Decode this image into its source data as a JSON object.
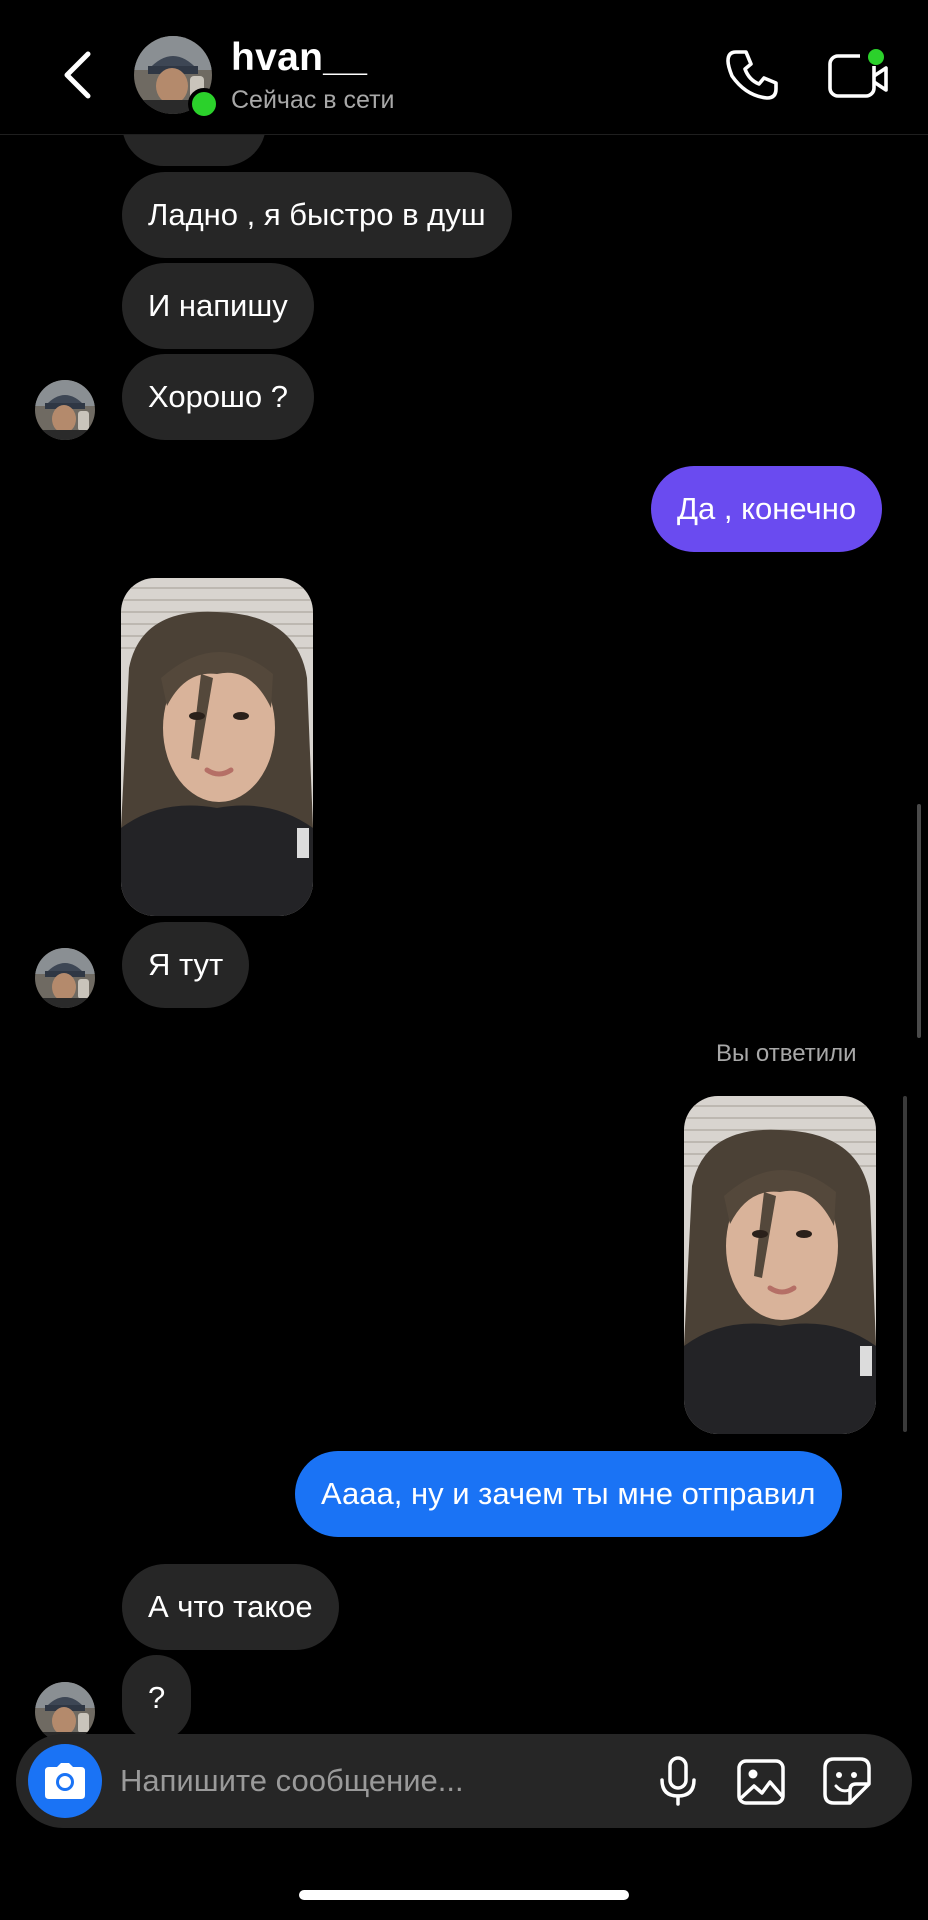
{
  "header": {
    "username": "hvan__",
    "status": "Сейчас в сети",
    "accent_online": "#2bd12b"
  },
  "icons": {
    "back": "chevron-left-icon",
    "call": "phone-icon",
    "video": "video-camera-icon",
    "camera": "camera-icon",
    "mic": "microphone-icon",
    "gallery": "image-icon",
    "sticker": "sticker-icon"
  },
  "messages": {
    "m1": "Ладно , я быстро в душ",
    "m2": "И напишу",
    "m3": "Хорошо ?",
    "m4": "Да , конечно",
    "m5": "Я тут",
    "reply_label": "Вы ответили",
    "m6": "Аааа, ну и зачем ты мне отправил",
    "m7": "А что такое",
    "m8": "?"
  },
  "composer": {
    "placeholder": "Напишите сообщение..."
  },
  "colors": {
    "incoming_bubble": "#262626",
    "outgoing_purple": "#6a4bf0",
    "outgoing_blue": "#1a73f5"
  }
}
